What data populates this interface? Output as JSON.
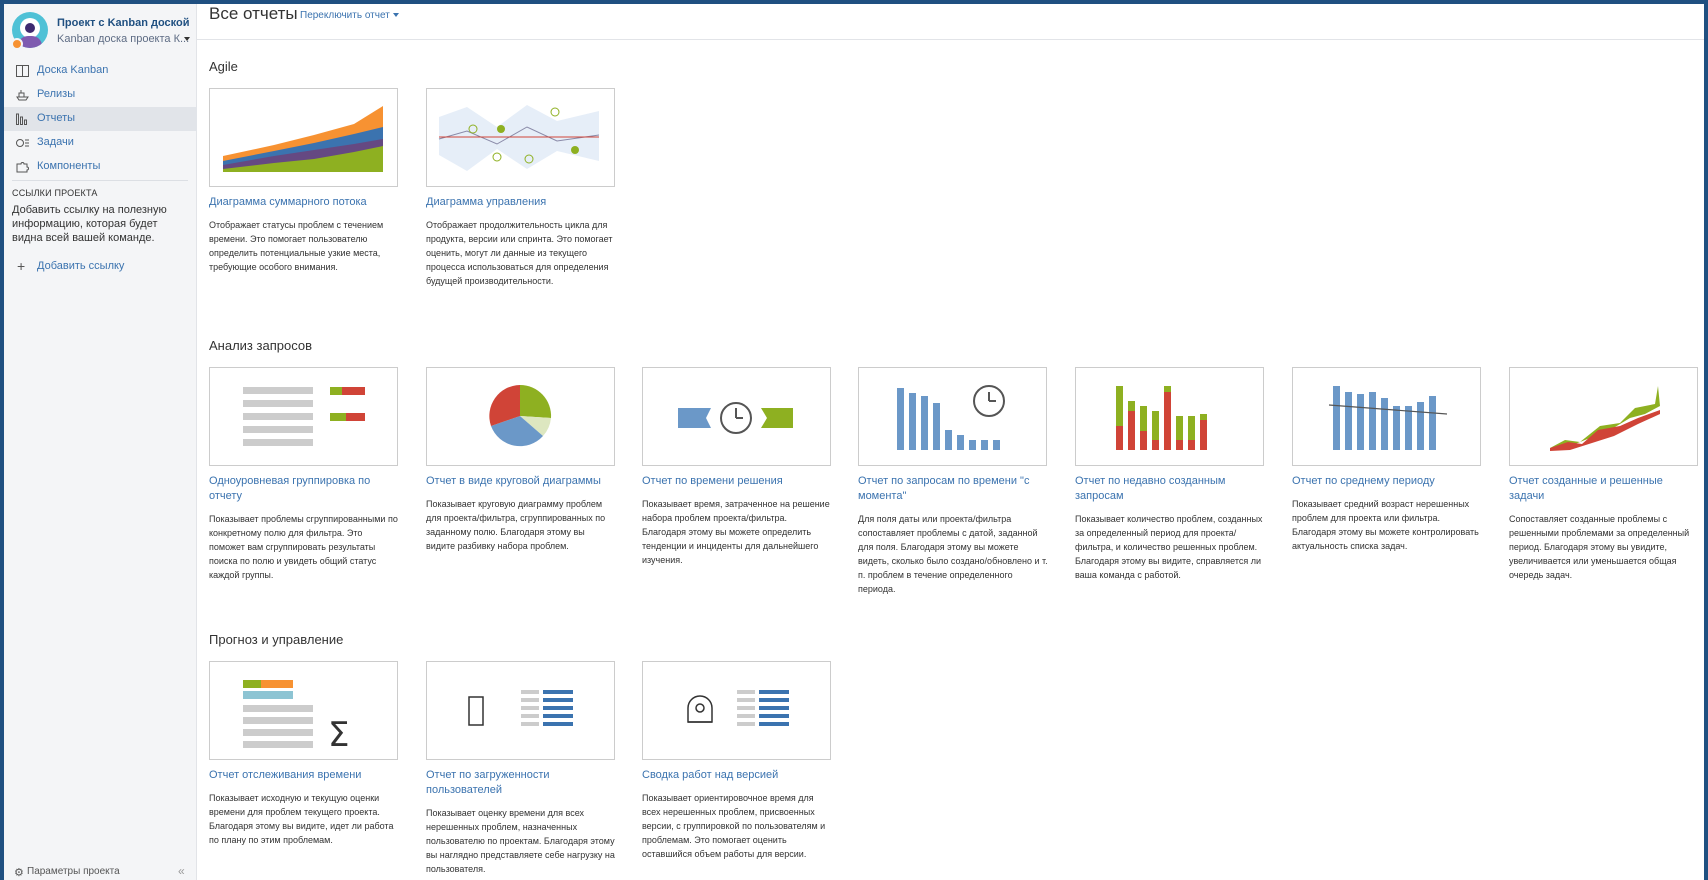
{
  "sidebar": {
    "project_name": "Проект с Kanban доской",
    "project_type": "Kanban доска проекта К...",
    "nav": [
      {
        "label": "Доска Kanban",
        "icon": "board-icon"
      },
      {
        "label": "Релизы",
        "icon": "ship-icon"
      },
      {
        "label": "Отчеты",
        "icon": "reports-icon"
      },
      {
        "label": "Задачи",
        "icon": "issues-icon"
      },
      {
        "label": "Компоненты",
        "icon": "puzzle-icon"
      }
    ],
    "links_heading": "ССЫЛКИ ПРОЕКТА",
    "links_text": "Добавить ссылку на полезную информацию, которая будет видна всей вашей команде.",
    "add_link": "Добавить ссылку",
    "settings": "Параметры проекта",
    "collapse": "«"
  },
  "header": {
    "title": "Все отчеты",
    "switch": "Переключить отчет"
  },
  "sections": [
    {
      "title": "Agile",
      "cards": [
        {
          "title": "Диаграмма суммарного потока",
          "desc": "Отображает статусы проблем с течением времени. Это помогает пользователю определить потенциальные узкие места, требующие особого внимания."
        },
        {
          "title": "Диаграмма управления",
          "desc": "Отображает продолжительность цикла для продукта, версии или спринта. Это помогает оценить, могут ли данные из текущего процесса использоваться для определения будущей производительности."
        }
      ]
    },
    {
      "title": "Анализ запросов",
      "cards": [
        {
          "title": "Одноуровневая группировка по отчету",
          "desc": "Показывает проблемы сгруппированными по конкретному полю для фильтра. Это поможет вам сгруппировать результаты поиска по полю и увидеть общий статус каждой группы."
        },
        {
          "title": "Отчет в виде круговой диаграммы",
          "desc": "Показывает круговую диаграмму проблем для проекта/фильтра, сгруппированных по заданному полю. Благодаря этому вы видите разбивку набора проблем."
        },
        {
          "title": "Отчет по времени решения",
          "desc": "Показывает время, затраченное на решение набора проблем проекта/фильтра. Благодаря этому вы можете определить тенденции и инциденты для дальнейшего изучения."
        },
        {
          "title": "Отчет по запросам по времени \"с момента\"",
          "desc": "Для поля даты или проекта/фильтра сопоставляет проблемы с датой, заданной для поля. Благодаря этому вы можете видеть, сколько было создано/обновлено и т. п. проблем в течение определенного периода."
        },
        {
          "title": "Отчет по недавно созданным запросам",
          "desc": "Показывает количество проблем, созданных за определенный период для проекта/фильтра, и количество решенных проблем. Благодаря этому вы видите, справляется ли ваша команда с работой."
        },
        {
          "title": "Отчет по среднему периоду",
          "desc": "Показывает средний возраст нерешенных проблем для проекта или фильтра. Благодаря этому вы можете контролировать актуальность списка задач."
        },
        {
          "title": "Отчет созданные и решенные задачи",
          "desc": "Сопоставляет созданные проблемы с решенными проблемами за определенный период. Благодаря этому вы увидите, увеличивается или уменьшается общая очередь задач."
        }
      ]
    },
    {
      "title": "Прогноз и управление",
      "cards": [
        {
          "title": "Отчет отслеживания времени",
          "desc": "Показывает исходную и текущую оценки времени для проблем текущего проекта. Благодаря этому вы видите, идет ли работа по плану по этим проблемам."
        },
        {
          "title": "Отчет по загруженности пользователей",
          "desc": "Показывает оценку времени для всех нерешенных проблем, назначенных пользователю по проектам. Благодаря этому вы наглядно представляете себе нагрузку на пользователя."
        },
        {
          "title": "Сводка работ над версией",
          "desc": "Показывает ориентировочное время для всех нерешенных проблем, присвоенных версии, с группировкой по пользователям и проблемам. Это помогает оценить оставшийся объем работы для версии."
        }
      ]
    }
  ],
  "colors": {
    "frame": "#205081",
    "link": "#3b73af",
    "orange": "#f79232",
    "blue": "#3b73af",
    "purple": "#654982",
    "green": "#8eb021",
    "red": "#d04437",
    "chart_blue": "#6b98c8"
  }
}
